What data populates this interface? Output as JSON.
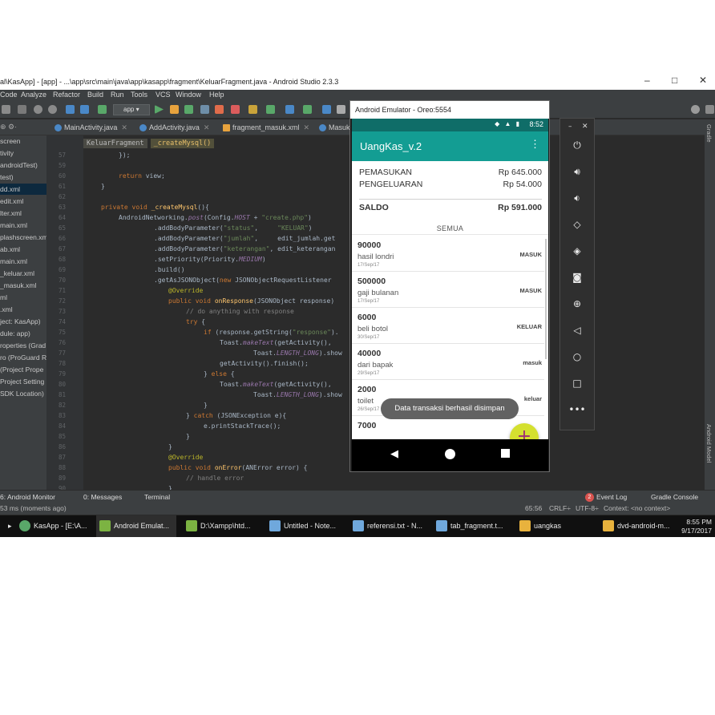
{
  "window": {
    "title": "al\\KasApp] - [app] - ...\\app\\src\\main\\java\\app\\kasapp\\fragment\\KeluarFragment.java - Android Studio 2.3.3",
    "minimize": "–",
    "maximize": "□",
    "close": "✕"
  },
  "menu": [
    "Code",
    "Analyze",
    "Refactor",
    "Build",
    "Run",
    "Tools",
    "VCS",
    "Window",
    "Help"
  ],
  "toolbar": {
    "run_config": "app"
  },
  "tabs": [
    "MainActivity.java",
    "AddActivity.java",
    "fragment_masuk.xml",
    "Masuk"
  ],
  "project_items": [
    {
      "label": "screen",
      "sel": false
    },
    {
      "label": "tivity",
      "sel": false
    },
    {
      "label": "androidTest)",
      "sel": false
    },
    {
      "label": "test)",
      "sel": false
    },
    {
      "label": "dd.xml",
      "sel": true
    },
    {
      "label": "edit.xml",
      "sel": false
    },
    {
      "label": "lter.xml",
      "sel": false
    },
    {
      "label": "main.xml",
      "sel": false
    },
    {
      "label": "plashscreen.xml",
      "sel": false
    },
    {
      "label": "ab.xml",
      "sel": false
    },
    {
      "label": "main.xml",
      "sel": false
    },
    {
      "label": "_keluar.xml",
      "sel": false
    },
    {
      "label": "_masuk.xml",
      "sel": false
    },
    {
      "label": "ml",
      "sel": false
    },
    {
      "label": ".xml",
      "sel": false
    },
    {
      "label": "ject: KasApp)",
      "sel": false
    },
    {
      "label": "dule: app)",
      "sel": false
    },
    {
      "label": "roperties (Grad",
      "sel": false
    },
    {
      "label": "ro (ProGuard R",
      "sel": false
    },
    {
      "label": "(Project Prope",
      "sel": false
    },
    {
      "label": "Project Setting",
      "sel": false
    },
    {
      "label": "SDK Location)",
      "sel": false
    }
  ],
  "breadcrumb": [
    "KeluarFragment",
    "_createMysql()"
  ],
  "line_numbers": [
    "57",
    "59",
    "60",
    "61",
    "62",
    "63",
    "64",
    "65",
    "66",
    "67",
    "68",
    "69",
    "70",
    "71",
    "72",
    "73",
    "74",
    "75",
    "76",
    "77",
    "78",
    "79",
    "80",
    "81",
    "82",
    "83",
    "84",
    "85",
    "86",
    "87",
    "88",
    "89",
    "90"
  ],
  "bottom_tools": {
    "android_monitor": "6: Android Monitor",
    "messages": "0: Messages",
    "terminal": "Terminal",
    "event_log": "Event Log",
    "event_badge": "2",
    "gradle_console": "Gradle Console"
  },
  "status": {
    "left": "53 ms (moments ago)",
    "pos": "65:56",
    "crlf": "CRLF÷",
    "enc": "UTF-8÷",
    "context": "Context: <no context>"
  },
  "right_strip": [
    "Gradle",
    "Android Model"
  ],
  "taskbar": {
    "items": [
      "KasApp - [E:\\A...",
      "Android Emulat...",
      "D:\\Xampp\\htd...",
      "Untitled - Note...",
      "referensi.txt - N...",
      "tab_fragment.t...",
      "uangkas",
      "dvd-android-m..."
    ],
    "time": "8:55 PM",
    "date": "9/17/2017"
  },
  "emulator": {
    "window_title": "Android Emulator - Oreo:5554",
    "status_time": "8:52",
    "app_title": "UangKas_v.2",
    "summary": {
      "pemasukan_label": "PEMASUKAN",
      "pemasukan_value": "Rp 645.000",
      "pengeluaran_label": "PENGELUARAN",
      "pengeluaran_value": "Rp 54.000",
      "saldo_label": "SALDO",
      "saldo_value": "Rp 591.000",
      "filter": "SEMUA"
    },
    "transactions": [
      {
        "amount": "90000",
        "desc": "hasil londri",
        "date": "17/Sep/17",
        "type": "MASUK"
      },
      {
        "amount": "500000",
        "desc": "gaji bulanan",
        "date": "17/Sep/17",
        "type": "MASUK"
      },
      {
        "amount": "6000",
        "desc": "beli botol",
        "date": "30/Sep/17",
        "type": "KELUAR"
      },
      {
        "amount": "40000",
        "desc": "dari bapak",
        "date": "29/Sep/17",
        "type": "masuk"
      },
      {
        "amount": "2000",
        "desc": "toilet",
        "date": "26/Sep/17",
        "type": "keluar"
      },
      {
        "amount": "7000",
        "desc": "",
        "date": "",
        "type": ""
      }
    ],
    "toast": "Data transaksi berhasil disimpan",
    "fab": "+"
  },
  "colors": {
    "app_primary": "#139d93",
    "app_status": "#0f6d68",
    "fab": "#d4e02f",
    "fab_plus": "#9e2c74",
    "ide_bg": "#2b2b2b"
  },
  "icons": [
    "android-icon",
    "wifi-icon",
    "signal-icon",
    "battery-icon",
    "overflow-menu-icon",
    "power-icon",
    "volume-up-icon",
    "volume-down-icon",
    "rotate-left-icon",
    "rotate-right-icon",
    "camera-icon",
    "zoom-icon",
    "back-icon",
    "home-icon",
    "overview-icon",
    "more-icon",
    "cursor-icon"
  ]
}
